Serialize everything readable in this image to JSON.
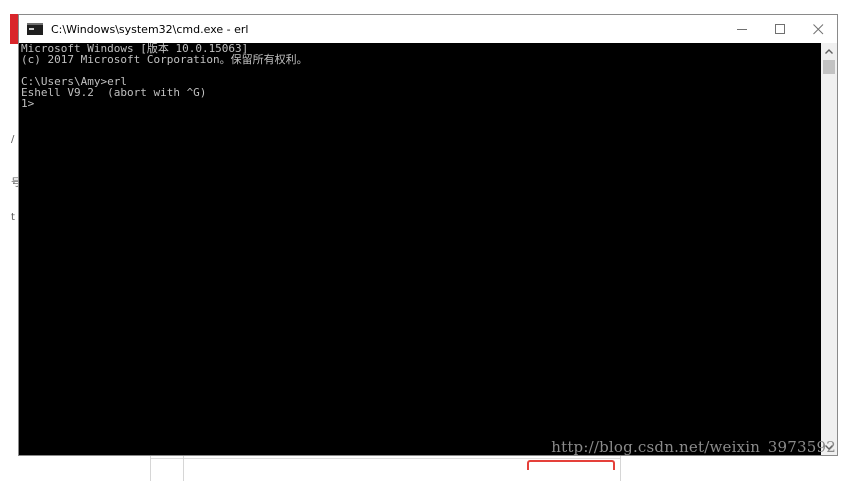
{
  "window": {
    "title": "C:\\Windows\\system32\\cmd.exe - erl",
    "minimize_glyph": "—",
    "maximize_glyph": "☐",
    "close_glyph": "✕"
  },
  "console": {
    "lines": [
      "Microsoft Windows [版本 10.0.15063]",
      "(c) 2017 Microsoft Corporation。保留所有权利。",
      "",
      "C:\\Users\\Amy>erl",
      "Eshell V9.2  (abort with ^G)",
      "1>"
    ]
  },
  "background": {
    "fragments": [
      "/",
      "号",
      "t"
    ]
  },
  "watermark": "http://blog.csdn.net/weixin_3973592",
  "icons": {
    "app": "console-app-icon",
    "scroll_up": "chevron-up-icon",
    "scroll_down": "chevron-down-icon"
  }
}
